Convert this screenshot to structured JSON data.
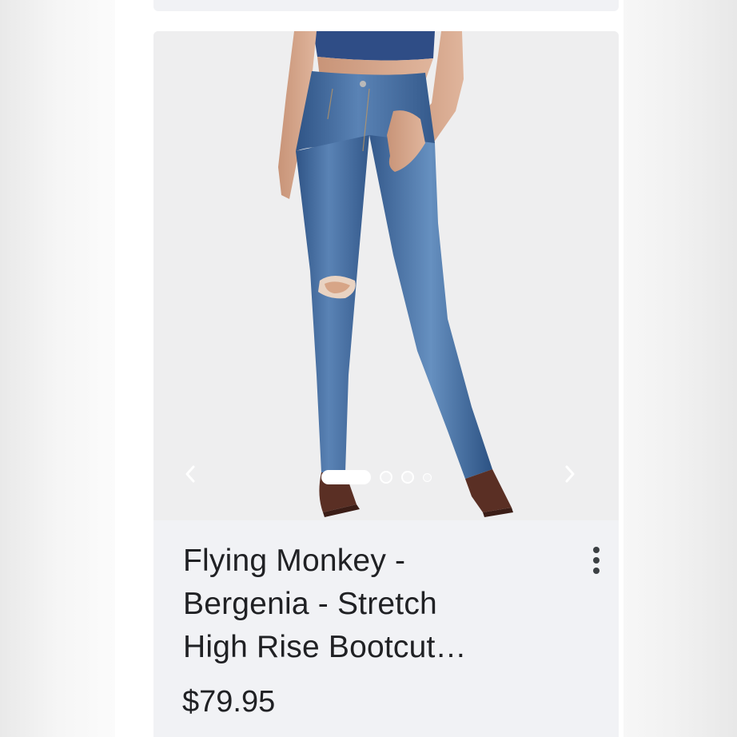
{
  "product": {
    "title_lines": [
      "Flying Monkey -",
      "Bergenia - Stretch",
      "High Rise Bootcut…"
    ],
    "price": "$79.95",
    "image": {
      "icon": "jeans-product-photo",
      "carousel": {
        "prev_icon": "chevron-left-icon",
        "next_icon": "chevron-right-icon",
        "total_images": 4,
        "active_index": 0
      }
    },
    "menu_icon": "more-vertical-icon"
  },
  "colors": {
    "card_background": "#f1f2f5",
    "text": "#202124",
    "denim": "#3f6a9e"
  }
}
